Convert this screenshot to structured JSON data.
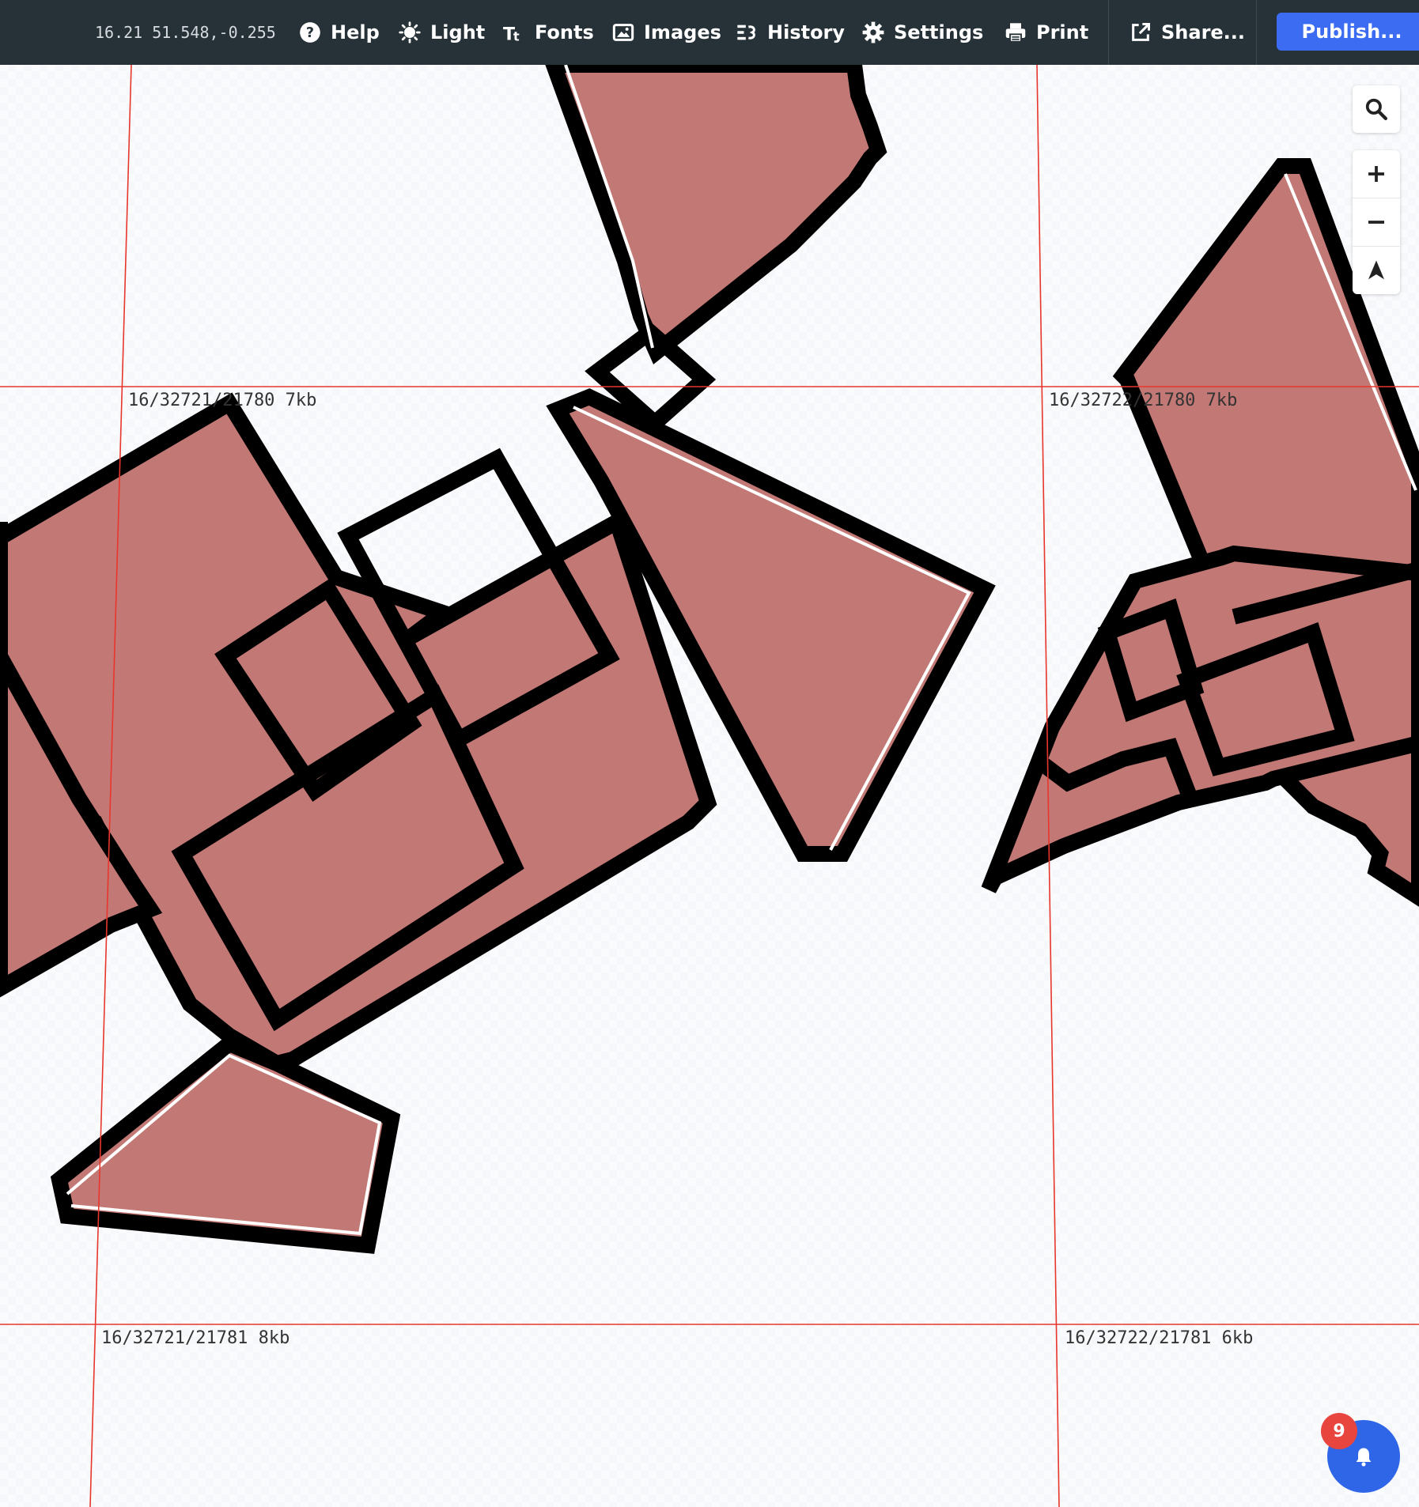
{
  "toolbar": {
    "coords": "16.21 51.548,-0.255",
    "help": "Help",
    "light": "Light",
    "fonts": "Fonts",
    "images": "Images",
    "history": "History",
    "settings": "Settings",
    "print": "Print",
    "share": "Share...",
    "publish": "Publish..."
  },
  "map": {
    "tile_labels": [
      "16/32721/21780 7kb",
      "16/32722/21780 7kb",
      "16/32721/21781 8kb",
      "16/32722/21781 6kb"
    ],
    "colors": {
      "building_fill": "#c27874",
      "outline": "#000000",
      "tile_grid": "#e8362d",
      "background": "#f4f6f9"
    }
  },
  "controls": {
    "search": "search-icon",
    "zoom_in": "plus-icon",
    "zoom_out": "minus-icon",
    "north": "compass-arrow-icon"
  },
  "notifications": {
    "count": "9"
  }
}
